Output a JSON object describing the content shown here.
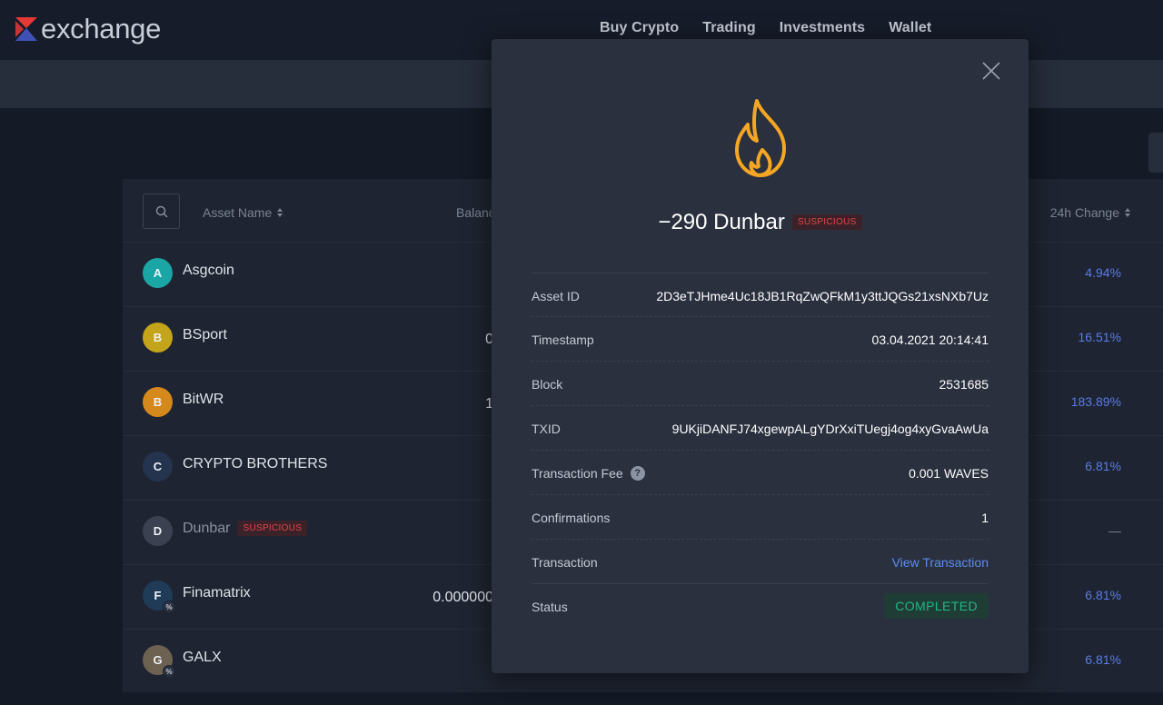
{
  "brand": {
    "logo_text": "exchange",
    "logo_colors": [
      "#e53935",
      "#3f51b5"
    ]
  },
  "nav": [
    "Buy Crypto",
    "Trading",
    "Investments",
    "Wallet"
  ],
  "table": {
    "headers": {
      "asset_name": "Asset Name",
      "balance": "Balance",
      "change_24h": "24h Change"
    },
    "rows": [
      {
        "letter": "A",
        "name": "Asgcoin",
        "balance": "",
        "change": "4.94%",
        "avatar_color": "#1ba6a6",
        "tag": ""
      },
      {
        "letter": "B",
        "name": "BSport",
        "balance": "0",
        "change": "16.51%",
        "avatar_color": "#c3a41b",
        "tag": ""
      },
      {
        "letter": "B",
        "name": "BitWR",
        "balance": "1",
        "change": "183.89%",
        "avatar_color": "#d5881c",
        "tag": ""
      },
      {
        "letter": "C",
        "name": "CRYPTO BROTHERS",
        "balance": "",
        "change": "6.81%",
        "avatar_color": "#24344f",
        "tag": ""
      },
      {
        "letter": "D",
        "name": "Dunbar",
        "balance": "",
        "change": "—",
        "avatar_color": "#3b4151",
        "tag": "SUSPICIOUS"
      },
      {
        "letter": "F",
        "name": "Finamatrix",
        "balance": "0.000000",
        "change": "6.81%",
        "avatar_color": "#1f3b57",
        "tag": "",
        "badge": "%"
      },
      {
        "letter": "G",
        "name": "GALX",
        "balance": "",
        "change": "6.81%",
        "avatar_color": "#6d6152",
        "tag": "",
        "badge": "%"
      }
    ]
  },
  "modal": {
    "amount": "−290 Dunbar",
    "tag": "SUSPICIOUS",
    "icon": "fire-icon",
    "icon_color": "#f5a623",
    "details": {
      "asset_id": {
        "label": "Asset ID",
        "value": "2D3eTJHme4Uc18JB1RqZwQFkM1y3ttJQGs21xsNXb7Uz"
      },
      "timestamp": {
        "label": "Timestamp",
        "value": "03.04.2021 20:14:41"
      },
      "block": {
        "label": "Block",
        "value": "2531685"
      },
      "txid": {
        "label": "TXID",
        "value": "9UKjiDANFJ74xgewpALgYDrXxiTUegj4og4xyGvaAwUa"
      },
      "fee": {
        "label": "Transaction Fee",
        "value": "0.001 WAVES"
      },
      "confirmations": {
        "label": "Confirmations",
        "value": "1"
      },
      "transaction": {
        "label": "Transaction",
        "value": "View Transaction"
      },
      "status": {
        "label": "Status",
        "value": "COMPLETED"
      }
    }
  }
}
